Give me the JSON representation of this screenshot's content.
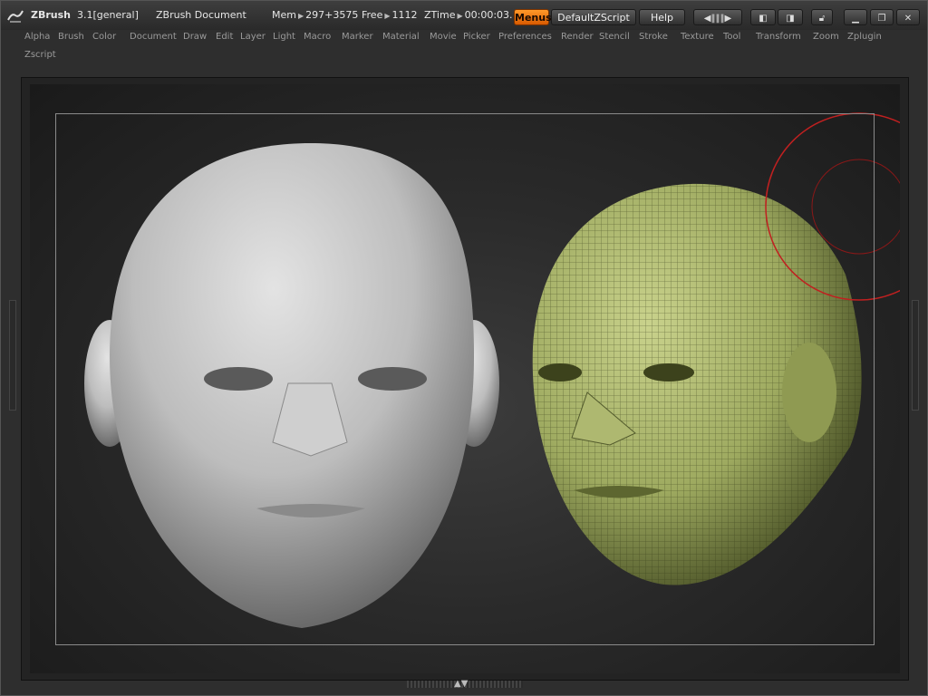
{
  "titlebar": {
    "app_name": "ZBrush",
    "version": "3.1[general]",
    "document": "ZBrush Document",
    "mem_label": "Mem",
    "mem_value": "297+3575",
    "free_label": "Free",
    "free_value": "1112",
    "ztime_label": "ZTime",
    "ztime_value": "00:00:03.",
    "menus_button": "Menus",
    "zscript_button": "DefaultZScript",
    "help_button": "Help"
  },
  "menu": {
    "items": [
      "Alpha",
      "Brush",
      "Color",
      "Document",
      "Draw",
      "Edit",
      "Layer",
      "Light",
      "Macro",
      "Marker",
      "Material",
      "Movie",
      "Picker",
      "Preferences",
      "Render",
      "Stencil",
      "Stroke",
      "Texture",
      "Tool",
      "Transform",
      "Zoom",
      "Zplugin",
      "Zscript"
    ]
  },
  "colors": {
    "accent": "#e86f0a",
    "head_gray": "#cfcfcf",
    "head_green": "#a4b06a",
    "brush_circle": "#c02020"
  },
  "icons": {
    "logo": "zbrush-logo-icon",
    "minimize": "minimize-icon",
    "restore": "restore-icon",
    "close": "close-icon",
    "lock": "lock-icon"
  }
}
